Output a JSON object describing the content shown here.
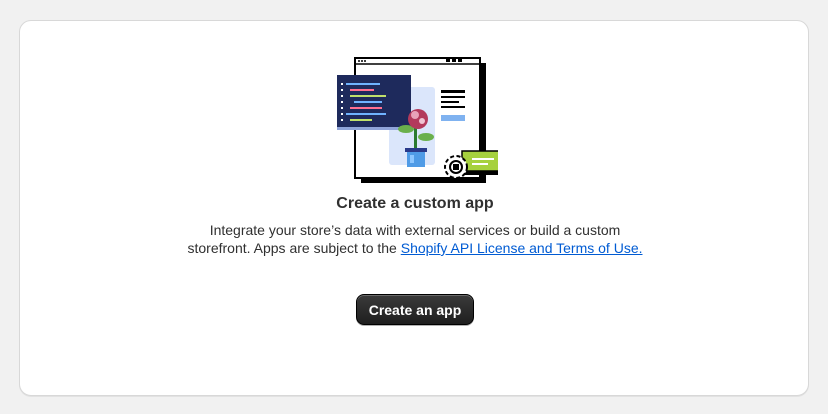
{
  "card": {
    "title": "Create a custom app",
    "description_prefix": "Integrate your store’s data with external services or build a custom storefront. Apps are subject to the ",
    "link_text": "Shopify API License and Terms of Use.",
    "button_label": "Create an app"
  },
  "colors": {
    "background": "#f1f1f1",
    "card": "#ffffff",
    "link": "#005bd3",
    "button": "#303030",
    "code_panel": "#1e2a5c",
    "accent_green": "#a6d13e",
    "accent_blue": "#a7c6f2"
  },
  "illustration": {
    "icons": [
      "code-window-icon",
      "browser-window-icon",
      "potted-plant-icon",
      "gear-icon"
    ]
  }
}
